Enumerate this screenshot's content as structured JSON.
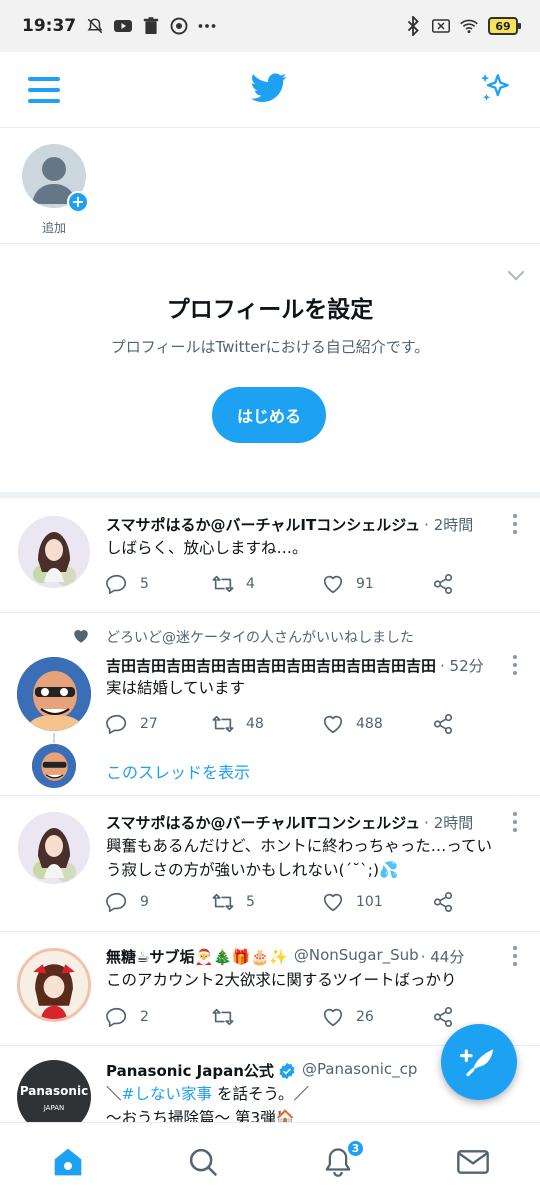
{
  "status_bar": {
    "time": "19:37",
    "battery": "69",
    "icons_left": [
      "mute-icon",
      "youtube-icon",
      "trash-icon",
      "chrome-icon",
      "more-dots-icon"
    ],
    "icons_right": [
      "bluetooth-icon",
      "no-sim-icon",
      "wifi-icon",
      "battery-icon"
    ]
  },
  "header": {
    "menu_icon": "hamburger-icon",
    "logo_icon": "twitter-bird-icon",
    "sparkle_icon": "sparkle-icon"
  },
  "fleets": {
    "add_label": "追加"
  },
  "profile_prompt": {
    "title": "プロフィールを設定",
    "subtitle": "プロフィールはTwitterにおける自己紹介です。",
    "button": "はじめる"
  },
  "tweets": [
    {
      "name": "スマサポはるか@バーチャルITコンシェルジュ",
      "time": "· 2時間",
      "text": "しばらく、放心しますね…。",
      "replies": "5",
      "retweets": "4",
      "likes": "91"
    },
    {
      "social_context": "どろいど@迷ケータイの人さんがいいねしました",
      "name": "吉田吉田吉田吉田吉田吉田吉田吉田吉田吉田吉田",
      "time": "· 52分",
      "text": "実は結婚しています",
      "replies": "27",
      "retweets": "48",
      "likes": "488",
      "show_thread": "このスレッドを表示"
    },
    {
      "name": "スマサポはるか@バーチャルITコンシェルジュ",
      "time": "· 2時間",
      "text_line1": "興奮もあるんだけど、ホントに終わっちゃった…ってい",
      "text_line2": "う寂しさの方が強いかもしれない(´˘`;)💦",
      "replies": "9",
      "retweets": "5",
      "likes": "101"
    },
    {
      "name": "無糖☕サブ垢🎅🎄🎁🎂✨",
      "handle": "@NonSugar_Sub",
      "time": "· 44分",
      "text": "このアカウント2大欲求に関するツイートばっかり",
      "replies": "2",
      "retweets": "",
      "likes": "26"
    },
    {
      "name": "Panasonic Japan公式",
      "handle": "@Panasonic_cp",
      "verified": true,
      "avatar_text": "Panasonic",
      "avatar_subtext": "JAPAN",
      "text_prefix": "＼",
      "text_hashtag": "#しない家事",
      "text_suffix": " を話そう。／",
      "text_line2": "～おうち掃除篇～ 第3弾🏠"
    }
  ],
  "bottom_nav": {
    "items": [
      "home-icon",
      "search-icon",
      "notifications-icon",
      "messages-icon"
    ],
    "notification_badge": "3"
  },
  "colors": {
    "accent": "#1da1f2",
    "secondary_text": "#536471",
    "divider": "#e6ecf0"
  }
}
